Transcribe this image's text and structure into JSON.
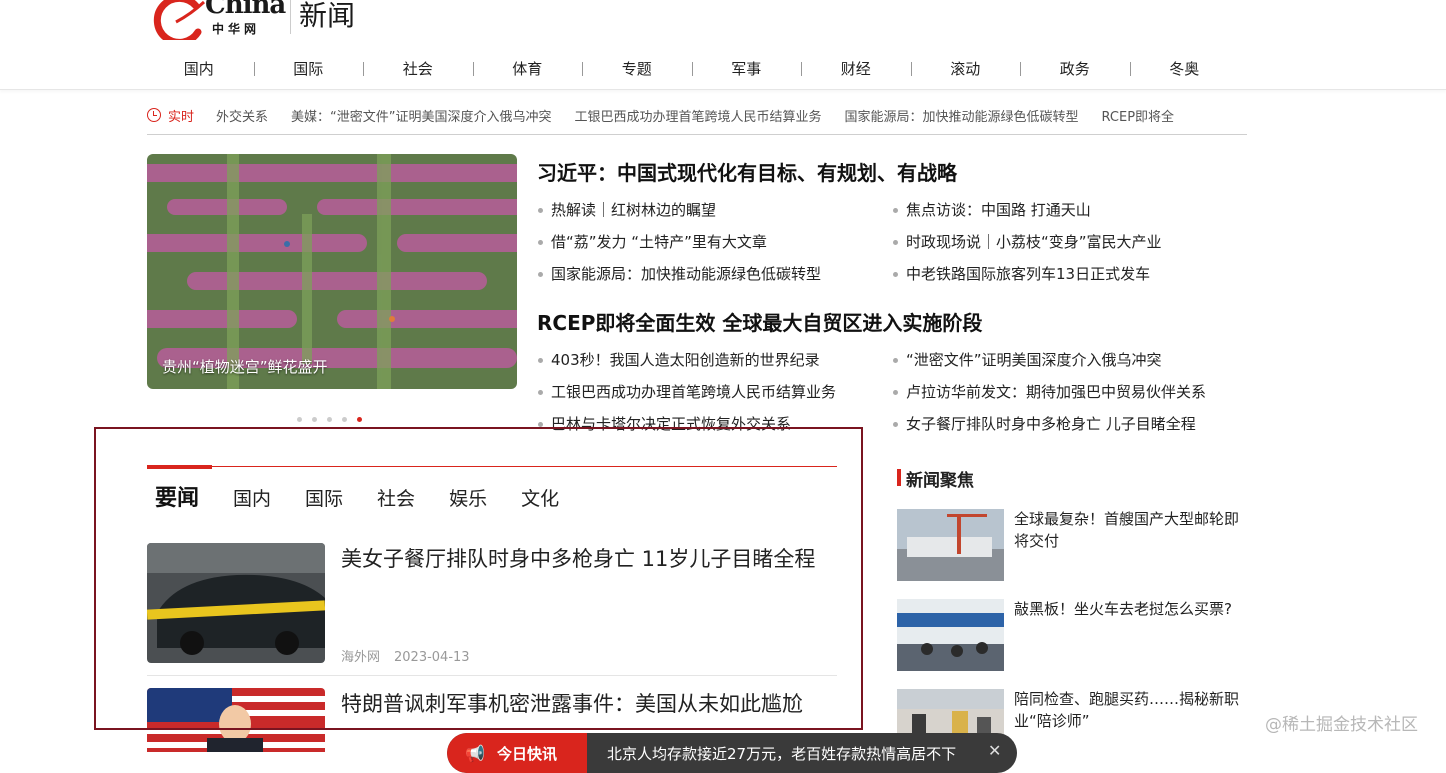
{
  "header": {
    "logo_text": "China",
    "logo_sub": "中华网",
    "channel_title": "新闻",
    "nav": [
      "国内",
      "国际",
      "社会",
      "体育",
      "专题",
      "军事",
      "财经",
      "滚动",
      "政务",
      "冬奥"
    ]
  },
  "ticker": {
    "label": "实时",
    "items": [
      "外交关系",
      "美媒：“泄密文件”证明美国深度介入俄乌冲突",
      "工银巴西成功办理首笔跨境人民币结算业务",
      "国家能源局：加快推动能源绿色低碳转型",
      "RCEP即将全"
    ]
  },
  "hero": {
    "caption": "贵州“植物迷宫”鲜花盛开",
    "active_dot": 5,
    "dot_count": 5
  },
  "top_news": [
    {
      "headline": "习近平：中国式现代化有目标、有规划、有战略",
      "links": [
        "热解读｜红树林边的瞩望",
        "焦点访谈：中国路 打通天山",
        "借“荔”发力 “土特产”里有大文章",
        "时政现场说｜小荔枝“变身”富民大产业",
        "国家能源局：加快推动能源绿色低碳转型",
        "中老铁路国际旅客列车13日正式发车"
      ]
    },
    {
      "headline": "RCEP即将全面生效 全球最大自贸区进入实施阶段",
      "links": [
        "403秒！我国人造太阳创造新的世界纪录",
        "“泄密文件”证明美国深度介入俄乌冲突",
        "工银巴西成功办理首笔跨境人民币结算业务",
        "卢拉访华前发文：期待加强巴中贸易伙伴关系",
        "巴林与卡塔尔决定正式恢复外交关系",
        "女子餐厅排队时身中多枪身亡 儿子目睹全程"
      ]
    }
  ],
  "tabs": [
    "要闻",
    "国内",
    "国际",
    "社会",
    "娱乐",
    "文化"
  ],
  "news_list": [
    {
      "title": "美女子餐厅排队时身中多枪身亡 11岁儿子目睹全程",
      "source": "海外网",
      "date": "2023-04-13"
    },
    {
      "title": "特朗普讽刺军事机密泄露事件：美国从未如此尴尬"
    }
  ],
  "focus": {
    "heading": "新闻聚焦",
    "items": [
      "全球最复杂！首艘国产大型邮轮即将交付",
      "敲黑板！坐火车去老挝怎么买票?",
      "陪同检查、跑腿买药……揭秘新职业“陪诊师”"
    ]
  },
  "popup": {
    "label": "今日快讯",
    "text": "北京人均存款接近27万元，老百姓存款热情高居不下"
  },
  "watermark": "@稀土掘金技术社区",
  "colors": {
    "accent": "#d9251d",
    "highlight": "#7a1420"
  }
}
